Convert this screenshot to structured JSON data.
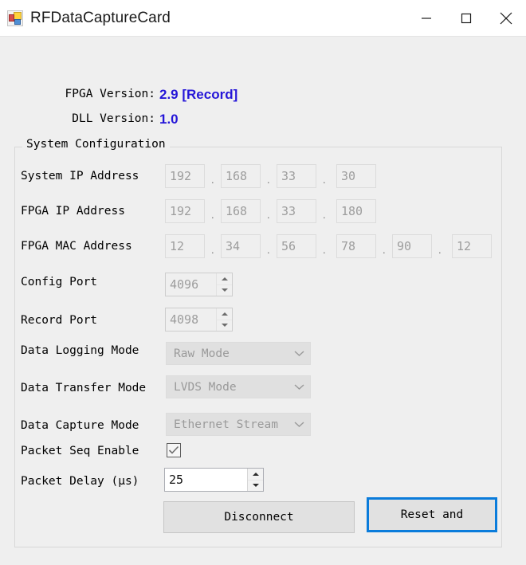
{
  "window": {
    "title": "RFDataCaptureCard",
    "icon": "app-icon",
    "controls": {
      "minimize": "minimize-icon",
      "maximize": "maximize-icon",
      "close": "close-icon"
    }
  },
  "colors": {
    "version_text": "#2516D8",
    "focus_border": "#0A7CDB",
    "client_background": "#EFEFEF",
    "titlebar_background": "#FFFFFF"
  },
  "info": {
    "fpga_version_label": "FPGA Version:",
    "fpga_version_value": "2.9 [Record]",
    "dll_version_label": "DLL Version:",
    "dll_version_value": "1.0"
  },
  "group": {
    "title": "System Configuration"
  },
  "fields": {
    "system_ip": {
      "label": "System IP Address",
      "octets": [
        "192",
        "168",
        "33",
        "30"
      ],
      "separator": "."
    },
    "fpga_ip": {
      "label": "FPGA IP Address",
      "octets": [
        "192",
        "168",
        "33",
        "180"
      ],
      "separator": "."
    },
    "fpga_mac": {
      "label": "FPGA MAC Address",
      "octets": [
        "12",
        "34",
        "56",
        "78",
        "90",
        "12"
      ],
      "separator": "."
    },
    "config_port": {
      "label": "Config Port",
      "value": "4096"
    },
    "record_port": {
      "label": "Record Port",
      "value": "4098"
    },
    "data_logging_mode": {
      "label": "Data Logging Mode",
      "value": "Raw Mode"
    },
    "data_transfer_mode": {
      "label": "Data Transfer Mode",
      "value": "LVDS Mode"
    },
    "data_capture_mode": {
      "label": "Data Capture Mode",
      "value": "Ethernet Stream"
    },
    "packet_seq_enable": {
      "label": "Packet Seq Enable",
      "checked": true
    },
    "packet_delay": {
      "label": "Packet Delay (μs)",
      "value": "25"
    }
  },
  "buttons": {
    "disconnect": "Disconnect",
    "reset_and": "Reset and"
  }
}
